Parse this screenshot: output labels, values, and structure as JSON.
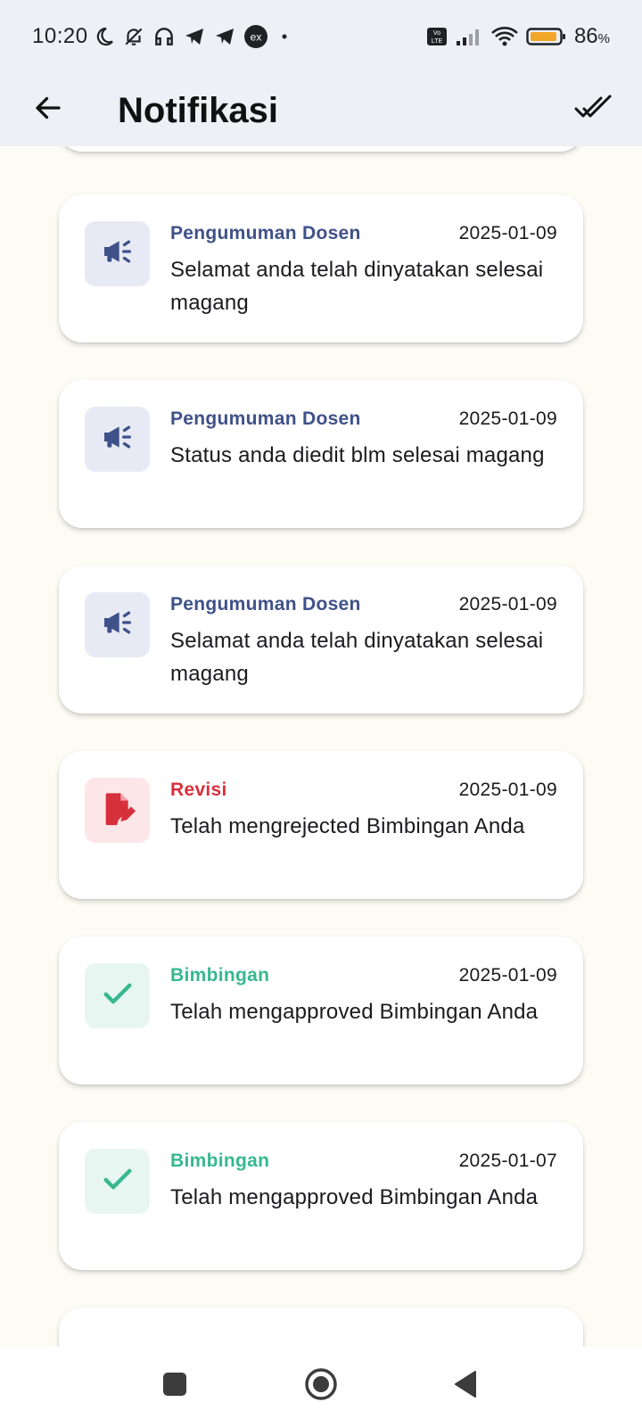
{
  "status_bar": {
    "time": "10:20",
    "battery_percent": "86",
    "battery_unit": "%",
    "icons_left": [
      "moon-icon",
      "bell-off-icon",
      "headphones-icon",
      "telegram-icon",
      "telegram-icon",
      "ex-app-icon",
      "dot-icon"
    ],
    "icons_right": [
      "volte-icon",
      "signal-icon",
      "wifi-icon",
      "battery-icon"
    ]
  },
  "app_bar": {
    "title": "Notifikasi",
    "back_icon": "arrow-back-icon",
    "mark_all_icon": "done-all-icon"
  },
  "colors": {
    "announce": "#3f5189",
    "revisi": "#d6303c",
    "bimbingan": "#37b88f",
    "background": "#fcfcf4",
    "appbar": "#eef0f6"
  },
  "notifications": [
    {
      "type": "announce",
      "icon": "megaphone-icon",
      "category": "Pengumuman Dosen",
      "date": "2025-01-09",
      "message": "Selamat anda telah dinyatakan selesai magang"
    },
    {
      "type": "announce",
      "icon": "megaphone-icon",
      "category": "Pengumuman Dosen",
      "date": "2025-01-09",
      "message": "Status anda diedit blm selesai magang"
    },
    {
      "type": "announce",
      "icon": "megaphone-icon",
      "category": "Pengumuman Dosen",
      "date": "2025-01-09",
      "message": "Selamat anda telah dinyatakan selesai magang"
    },
    {
      "type": "revisi",
      "icon": "edit-document-icon",
      "category": "Revisi",
      "date": "2025-01-09",
      "message": "Telah mengrejected Bimbingan Anda"
    },
    {
      "type": "bimbingan",
      "icon": "check-icon",
      "category": "Bimbingan",
      "date": "2025-01-09",
      "message": "Telah mengapproved Bimbingan Anda"
    },
    {
      "type": "bimbingan",
      "icon": "check-icon",
      "category": "Bimbingan",
      "date": "2025-01-07",
      "message": "Telah mengapproved Bimbingan Anda"
    }
  ],
  "nav_bar": {
    "icons": [
      "recents-square-icon",
      "home-circle-icon",
      "back-triangle-icon"
    ]
  }
}
